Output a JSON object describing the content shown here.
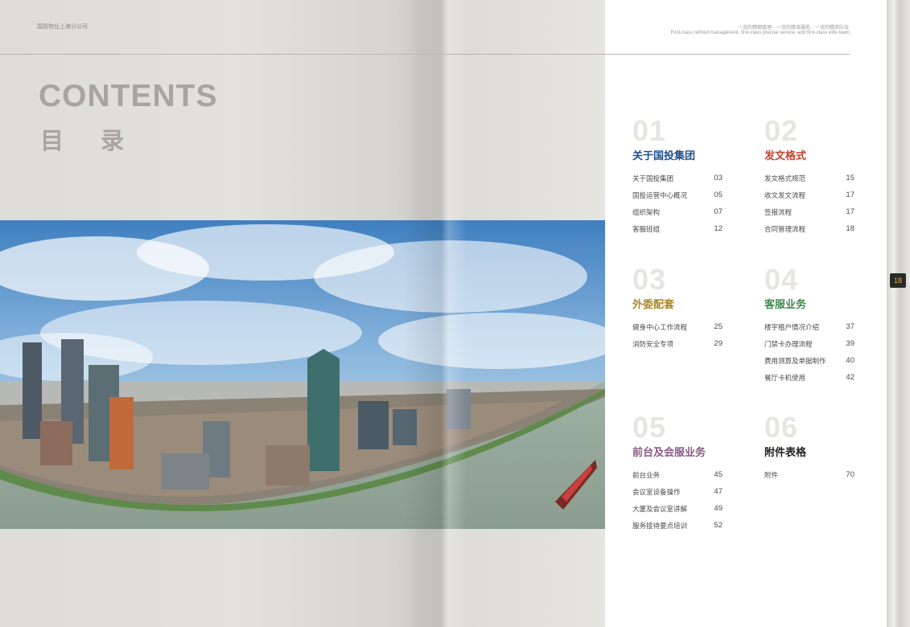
{
  "header": {
    "company": "国投物业上海分公司",
    "slogan_cn": "一流的精细管理、一流的精准服务、一流的精英队伍",
    "slogan_en": "First-class refined management, first-class precise service, and first-class elite team"
  },
  "title": {
    "en": "CONTENTS",
    "cn": "目 录"
  },
  "colors": {
    "blue": "#1f4f8f",
    "red": "#c8402a",
    "gold": "#a8892b",
    "green": "#3f8a4e",
    "purple": "#8a5a86",
    "black": "#222222"
  },
  "sections": [
    {
      "num": "01",
      "title": "关于国投集团",
      "color": "#1f4f8f",
      "items": [
        {
          "label": "关于国投集团",
          "page": "03"
        },
        {
          "label": "国投运营中心概况",
          "page": "05"
        },
        {
          "label": "组织架构",
          "page": "07"
        },
        {
          "label": "客服班组",
          "page": "12"
        }
      ]
    },
    {
      "num": "02",
      "title": "发文格式",
      "color": "#c8402a",
      "items": [
        {
          "label": "发文格式规范",
          "page": "15"
        },
        {
          "label": "收文发文流程",
          "page": "17"
        },
        {
          "label": "签报流程",
          "page": "17"
        },
        {
          "label": "合同管理流程",
          "page": "18"
        }
      ]
    },
    {
      "num": "03",
      "title": "外委配套",
      "color": "#a8892b",
      "items": [
        {
          "label": "健身中心工作流程",
          "page": "25"
        },
        {
          "label": "消防安全专项",
          "page": "29"
        }
      ]
    },
    {
      "num": "04",
      "title": "客服业务",
      "color": "#3f8a4e",
      "items": [
        {
          "label": "楼宇租户情况介绍",
          "page": "37"
        },
        {
          "label": "门禁卡办理流程",
          "page": "39"
        },
        {
          "label": "费用测算及单据制作",
          "page": "40"
        },
        {
          "label": "餐厅卡机使用",
          "page": "42"
        }
      ]
    },
    {
      "num": "05",
      "title": "前台及会服业务",
      "color": "#8a5a86",
      "items": [
        {
          "label": "前台业务",
          "page": "45"
        },
        {
          "label": "会议室设备操作",
          "page": "47"
        },
        {
          "label": "大厦及会议室讲解",
          "page": "49"
        },
        {
          "label": "服务接待要点培训",
          "page": "52"
        }
      ]
    },
    {
      "num": "06",
      "title": "附件表格",
      "color": "#222222",
      "items": [
        {
          "label": "附件",
          "page": "70"
        }
      ]
    }
  ],
  "page_tab": "18"
}
